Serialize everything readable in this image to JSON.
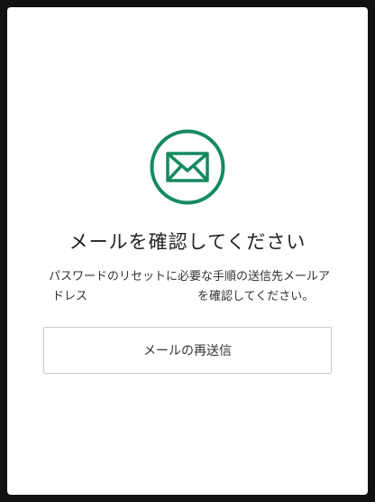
{
  "colors": {
    "accent": "#158a5f",
    "background": "#111111",
    "card": "#ffffff",
    "text": "#222222",
    "button_border": "#c8c8c8"
  },
  "icon": "envelope-in-circle-icon",
  "title": "メールを確認してください",
  "description": {
    "line1": "パスワードのリセットに必要な手順の送信先メールア",
    "line2_prefix": "ドレス",
    "line2_suffix": "を確認してください。"
  },
  "resend_button": {
    "label": "メールの再送信"
  }
}
